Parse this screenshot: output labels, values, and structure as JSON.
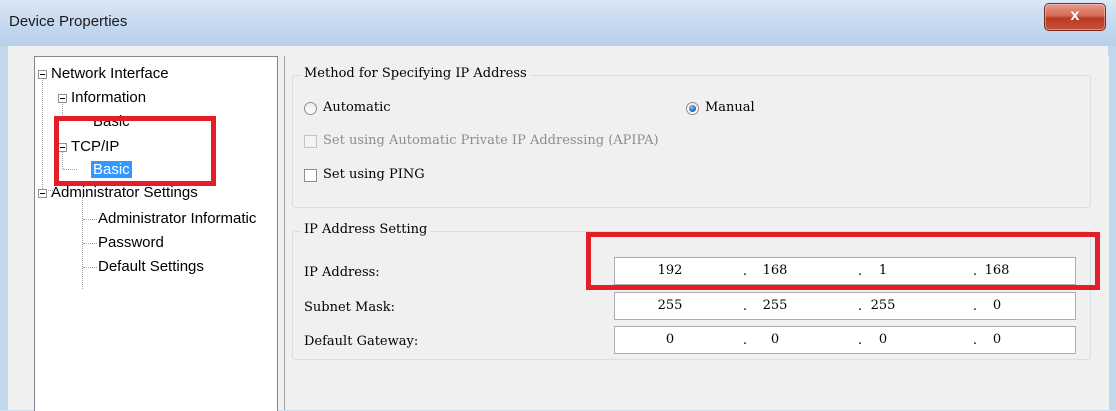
{
  "window": {
    "title": "Device Properties",
    "close_glyph": "x"
  },
  "tree": {
    "items": [
      {
        "label": "Network Interface"
      },
      {
        "label": "Information"
      },
      {
        "label": "Basic"
      },
      {
        "label": "TCP/IP"
      },
      {
        "label": "Basic"
      },
      {
        "label": "Administrator Settings"
      },
      {
        "label": "Administrator Informatic"
      },
      {
        "label": "Password"
      },
      {
        "label": "Default Settings"
      }
    ]
  },
  "method": {
    "title": "Method for Specifying IP Address",
    "automatic": "Automatic",
    "manual": "Manual",
    "selected": "Manual",
    "apipa": "Set using Automatic Private IP Addressing (APIPA)",
    "ping": "Set using PING"
  },
  "ip": {
    "title": "IP Address Setting",
    "rows": [
      {
        "label": "IP Address:",
        "octets": [
          "192",
          "168",
          "1",
          "168"
        ]
      },
      {
        "label": "Subnet Mask:",
        "octets": [
          "255",
          "255",
          "255",
          "0"
        ]
      },
      {
        "label": "Default Gateway:",
        "octets": [
          "0",
          "0",
          "0",
          "0"
        ]
      }
    ],
    "separator": "."
  },
  "colors": {
    "highlight_box": "#e41e26",
    "selection": "#3399ff"
  }
}
